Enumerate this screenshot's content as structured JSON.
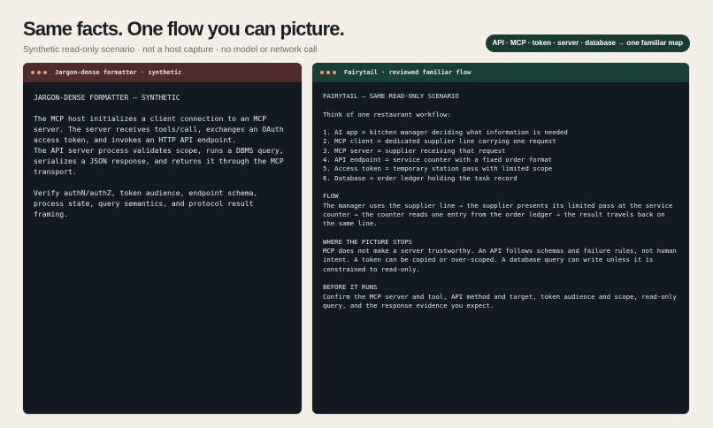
{
  "header": {
    "title": "Same facts. One flow you can picture.",
    "subtitle": "Synthetic read-only scenario · not a host capture · no model or network call",
    "tag": "API · MCP · token · server · database → one familiar map"
  },
  "left_panel": {
    "title": "Jargon-dense formatter · synthetic",
    "body": "JARGON-DENSE FORMATTER — SYNTHETIC\n\nThe MCP host initializes a client connection to an MCP server. The server receives tools/call, exchanges an OAuth access token, and invokes an HTTP API endpoint.\nThe API server process validates scope, runs a DBMS query, serializes a JSON response, and returns it through the MCP transport.\n\nVerify authN/authZ, token audience, endpoint schema, process state, query semantics, and protocol result framing."
  },
  "right_panel": {
    "title": "Fairytail · reviewed familiar flow",
    "body": "FAIRYTAIL — SAME READ-ONLY SCENARIO\n\nThink of one restaurant workflow:\n\n1. AI app = kitchen manager deciding what information is needed\n2. MCP client = dedicated supplier line carrying one request\n3. MCP server = supplier receiving that request\n4. API endpoint = service counter with a fixed order format\n5. Access token = temporary station pass with limited scope\n6. Database = order ledger holding the task record\n\nFLOW\nThe manager uses the supplier line → the supplier presents its limited pass at the service counter → the counter reads one entry from the order ledger → the result travels back on the same line.\n\nWHERE THE PICTURE STOPS\nMCP does not make a server trustworthy. An API follows schemas and failure rules, not human intent. A token can be copied or over-scoped. A database query can write unless it is constrained to read-only.\n\nBEFORE IT RUNS\nConfirm the MCP server and tool, API method and target, token audience and scope, read-only query, and the response evidence you expect."
  },
  "colors": {
    "background": "#f4efe6",
    "panel_bg": "#131920",
    "left_bar": "#4d2c2e",
    "right_bar": "#183f38",
    "dot": "#e8a26a",
    "pill_bg": "#183c33"
  },
  "icons": {
    "window_controls": "window-dots-icon"
  }
}
